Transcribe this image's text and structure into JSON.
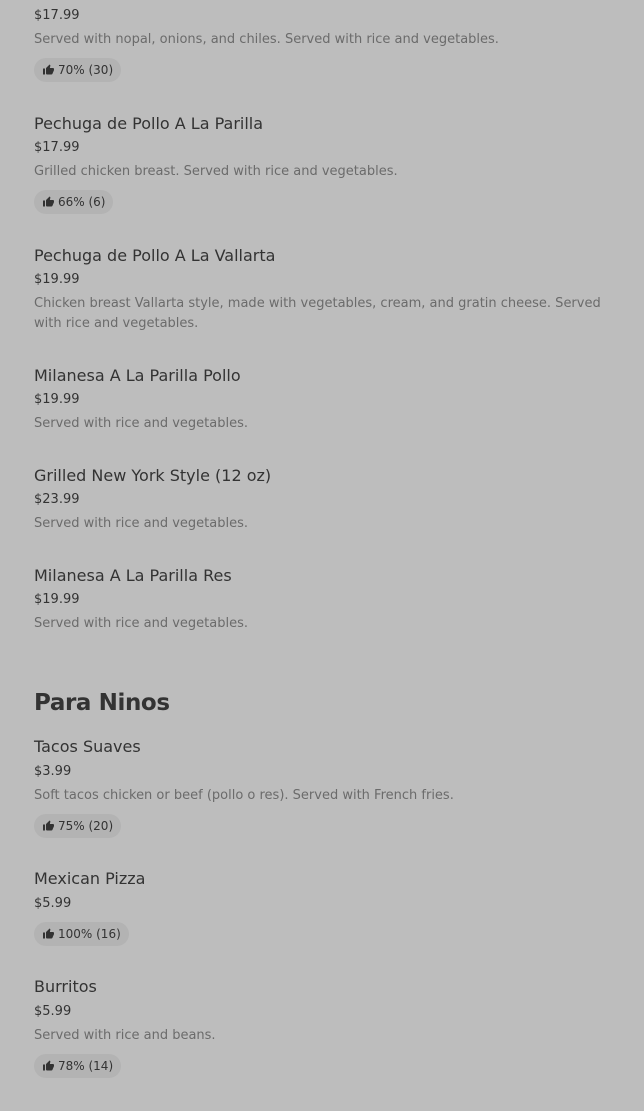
{
  "sections": [
    {
      "title": "",
      "items": [
        {
          "name": "",
          "price": "$17.99",
          "description": "Served with nopal, onions, and chiles. Served with rice and vegetables.",
          "rating": "70% (30)"
        },
        {
          "name": "Pechuga de Pollo A La Parilla",
          "price": "$17.99",
          "description": "Grilled chicken breast. Served with rice and vegetables.",
          "rating": "66% (6)"
        },
        {
          "name": "Pechuga de Pollo A La Vallarta",
          "price": "$19.99",
          "description": "Chicken breast Vallarta style, made with vegetables, cream, and gratin cheese. Served with rice and vegetables.",
          "rating": ""
        },
        {
          "name": "Milanesa A La Parilla Pollo",
          "price": "$19.99",
          "description": "Served with rice and vegetables.",
          "rating": ""
        },
        {
          "name": "Grilled New York Style (12 oz)",
          "price": "$23.99",
          "description": "Served with rice and vegetables.",
          "rating": ""
        },
        {
          "name": "Milanesa A La Parilla Res",
          "price": "$19.99",
          "description": "Served with rice and vegetables.",
          "rating": ""
        }
      ]
    },
    {
      "title": "Para Ninos",
      "items": [
        {
          "name": "Tacos Suaves",
          "price": "$3.99",
          "description": "Soft tacos chicken or beef (pollo o res). Served with French fries.",
          "rating": "75% (20)"
        },
        {
          "name": "Mexican Pizza",
          "price": "$5.99",
          "description": "",
          "rating": "100% (16)"
        },
        {
          "name": "Burritos",
          "price": "$5.99",
          "description": "Served with rice and beans.",
          "rating": "78% (14)"
        }
      ]
    }
  ],
  "icons": {
    "rating": "thumbs-up-icon"
  },
  "colors": {
    "background": "#bdbdbd",
    "text": "#333333",
    "muted_text": "#6b6b6b",
    "rating_pill": "#b3b3b3"
  }
}
